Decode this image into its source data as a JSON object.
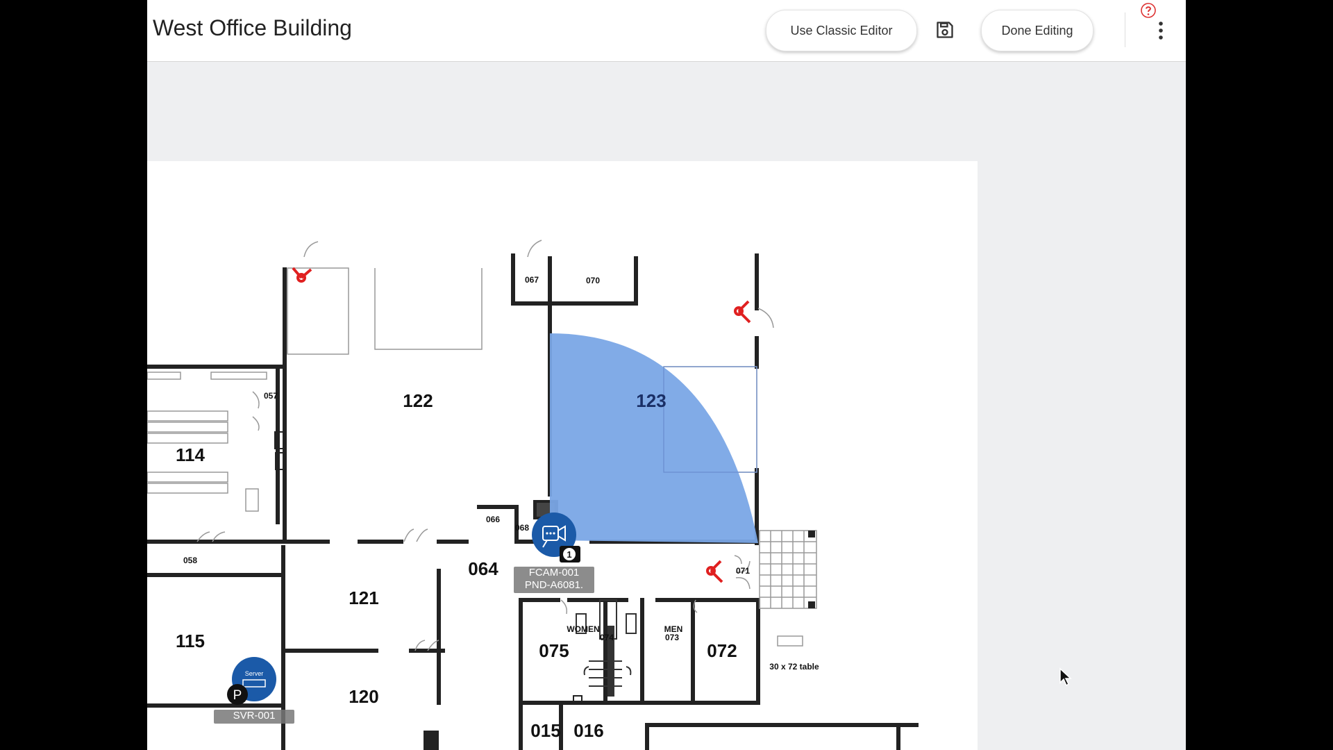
{
  "header": {
    "title": "West Office Building",
    "classic_editor_label": "Use Classic Editor",
    "done_label": "Done Editing",
    "save_icon": "save-icon",
    "more_icon": "more-vertical-icon",
    "help_icon": "help-icon"
  },
  "floorplan": {
    "rooms": {
      "r067": "067",
      "r070": "070",
      "r057": "057",
      "r114": "114",
      "r122": "122",
      "r123": "123",
      "r066": "066",
      "r068": "068",
      "r064": "064",
      "r071": "071",
      "r058": "058",
      "r121": "121",
      "r115": "115",
      "r075": "075",
      "r072": "072",
      "r120": "120",
      "r015": "015",
      "r016": "016",
      "women": "WOMEN",
      "r074": "074",
      "men": "MEN",
      "r073": "073"
    },
    "table_label": "30 x 72 table",
    "camera": {
      "id": "FCAM-001",
      "model": "PND-A6081.",
      "badge": "1",
      "fov_color": "#7aa6e6"
    },
    "server": {
      "id": "SVR-001",
      "icon_text": "Server",
      "badge": "P",
      "color": "#1b5aa8"
    },
    "door_sensor_color": "#e02020"
  }
}
